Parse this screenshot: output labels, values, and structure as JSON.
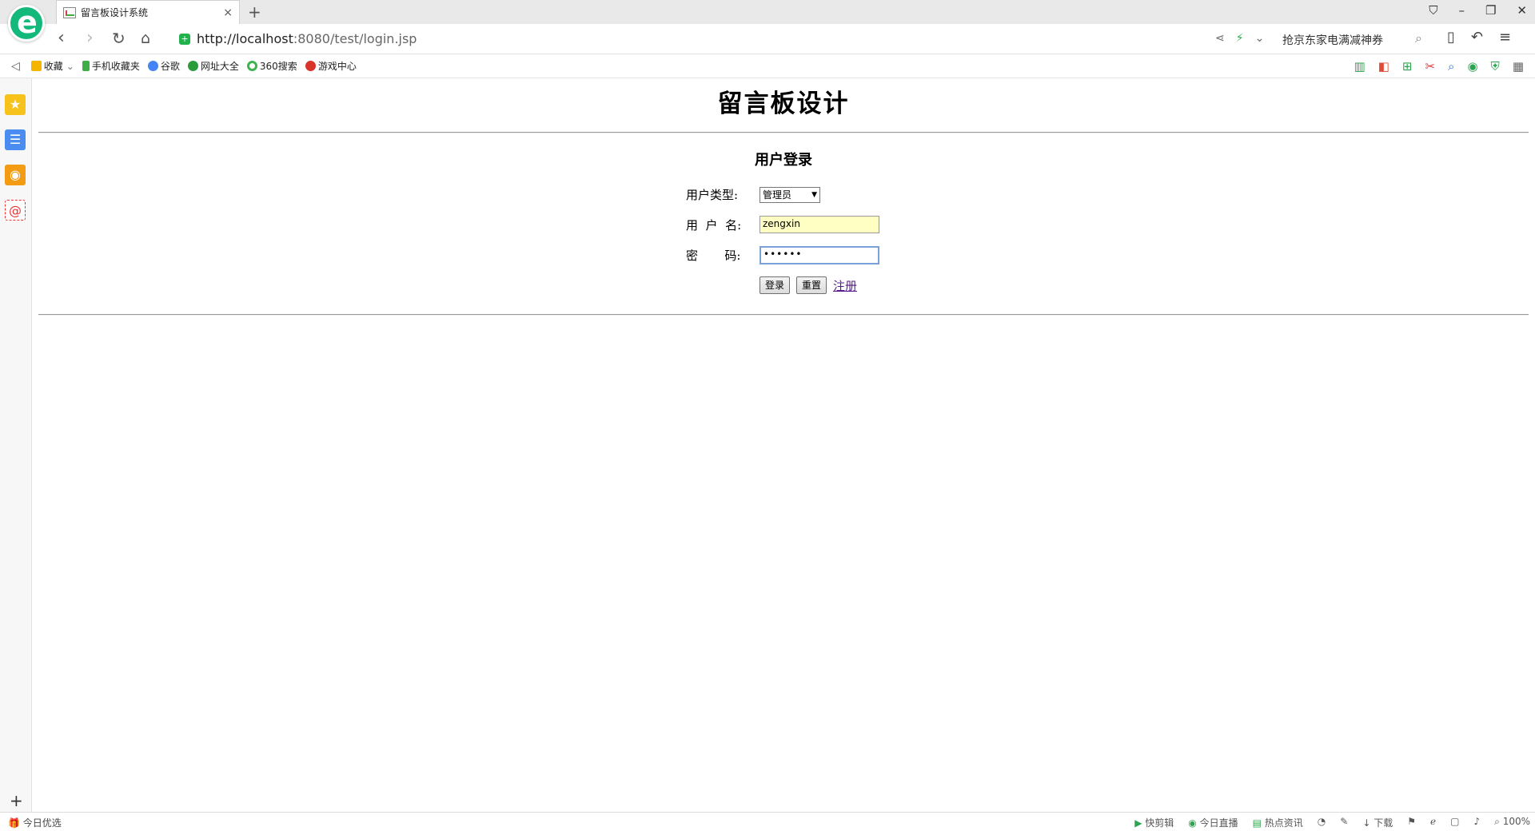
{
  "browser": {
    "tab_title": "留言板设计系统",
    "tab_close": "×",
    "new_tab": "+",
    "url_host": "http://localhost",
    "url_rest": ":8080/test/login.jsp",
    "search_promo": "抢京东家电满减神券",
    "logo_letter": "e"
  },
  "bookmarks": {
    "items": [
      {
        "label": "收藏",
        "icon": "star-icon",
        "color": "#f5b400"
      },
      {
        "label": "手机收藏夹",
        "icon": "phone-icon",
        "color": "#3fae49"
      },
      {
        "label": "谷歌",
        "icon": "google-icon",
        "color": "#4285f4"
      },
      {
        "label": "网址大全",
        "icon": "globe-icon",
        "color": "#2a9d3a"
      },
      {
        "label": "360搜索",
        "icon": "search-360-icon",
        "color": "#3fb34f"
      },
      {
        "label": "游戏中心",
        "icon": "game-icon",
        "color": "#d9342b"
      }
    ]
  },
  "status": {
    "left": "今日优选",
    "right": [
      "快剪辑",
      "今日直播",
      "热点资讯",
      "下载",
      "100%"
    ]
  },
  "page": {
    "heading": "留言板设计",
    "subheading": "用户登录",
    "user_type_label": "用户类型:",
    "user_type_value": "管理员",
    "username_label": "用  户  名:",
    "username_value": "zengxin",
    "password_label": "密       码:",
    "password_value": "••••••",
    "login_button": "登录",
    "reset_button": "重置",
    "register_link": "注册"
  },
  "colors": {
    "accent": "#13b87b",
    "link": "#551a8b",
    "input_autofill": "#ffffc4"
  }
}
